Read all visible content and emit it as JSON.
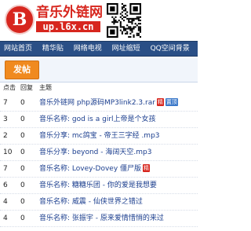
{
  "header": {
    "logo_letter": "B",
    "logo_title": "音乐外链网",
    "logo_url": "up.l6x.cn"
  },
  "nav": {
    "items": [
      "网站首页",
      "精华贴",
      "网络电视",
      "网址缩短",
      "QQ空间背景"
    ]
  },
  "post_button": "发帖",
  "table": {
    "headers": [
      "点击",
      "回复",
      "主题"
    ],
    "rows": [
      {
        "clicks": "7",
        "replies": "0",
        "title": "音乐外链网 php源码MP3link2.3.rar",
        "badges": [
          {
            "label": "精",
            "kind": "jing"
          },
          {
            "label": "置顶",
            "kind": "zhiding"
          }
        ]
      },
      {
        "clicks": "3",
        "replies": "0",
        "title": "音乐名称: god is a girl上帝是个女孩",
        "badges": []
      },
      {
        "clicks": "2",
        "replies": "0",
        "title": "音乐分享: mc鸽宝 - 帝王三字经 .mp3",
        "badges": []
      },
      {
        "clicks": "10",
        "replies": "0",
        "title": "音乐分享: beyond - 海阔天空.mp3",
        "badges": []
      },
      {
        "clicks": "7",
        "replies": "0",
        "title": "音乐名称: Lovey-Dovey 僵尸版",
        "badges": [
          {
            "label": "精",
            "kind": "jing"
          }
        ]
      },
      {
        "clicks": "6",
        "replies": "0",
        "title": "音乐名称: 糖糖乐团 - 你的爱是我想要",
        "badges": []
      },
      {
        "clicks": "4",
        "replies": "0",
        "title": "音乐名称: 威震 - 仙侠世界之错过",
        "badges": []
      },
      {
        "clicks": "4",
        "replies": "0",
        "title": "音乐名称: 张振宇 - 原来爱情惜悄的来过",
        "badges": []
      }
    ]
  },
  "colors": {
    "brand_red": "#d7261e",
    "nav_blue": "#2a4f86",
    "post_orange": "#f08a1f",
    "link_blue": "#1c3f8f"
  },
  "icons": {
    "logo": "b-circle-logo",
    "qr": "qr-code-icon"
  }
}
